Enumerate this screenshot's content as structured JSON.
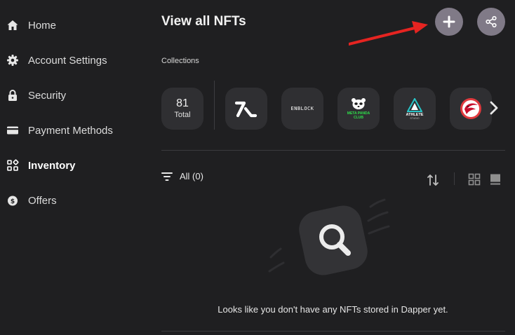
{
  "sidebar": {
    "items": [
      {
        "label": "Home",
        "icon": "home-icon",
        "active": false
      },
      {
        "label": "Account Settings",
        "icon": "gear-icon",
        "active": false
      },
      {
        "label": "Security",
        "icon": "lock-icon",
        "active": false
      },
      {
        "label": "Payment Methods",
        "icon": "credit-card-icon",
        "active": false
      },
      {
        "label": "Inventory",
        "icon": "inventory-icon",
        "active": true
      },
      {
        "label": "Offers",
        "icon": "offers-icon",
        "active": false
      }
    ]
  },
  "header": {
    "title": "View all NFTs",
    "add_icon": "plus-icon",
    "share_icon": "share-icon"
  },
  "collections": {
    "label": "Collections",
    "total_count": "81",
    "total_label": "Total",
    "items": [
      {
        "name": "onefootball-logo"
      },
      {
        "name": "enbloc-logo",
        "text": "ENBLOCK"
      },
      {
        "name": "meta-panda-club-logo",
        "text": "META PANDA CLUB"
      },
      {
        "name": "athlete-studio-logo",
        "text": "ATHLETE",
        "subtext": "STUDIO"
      },
      {
        "name": "atlanta-hawks-logo"
      }
    ]
  },
  "filter": {
    "label": "All (0)"
  },
  "empty_state": {
    "message": "Looks like you don't have any NFTs stored in Dapper yet."
  },
  "colors": {
    "background": "#1f1f21",
    "tile": "#2f2f32",
    "button": "#807a87",
    "arrow": "#e52421"
  }
}
